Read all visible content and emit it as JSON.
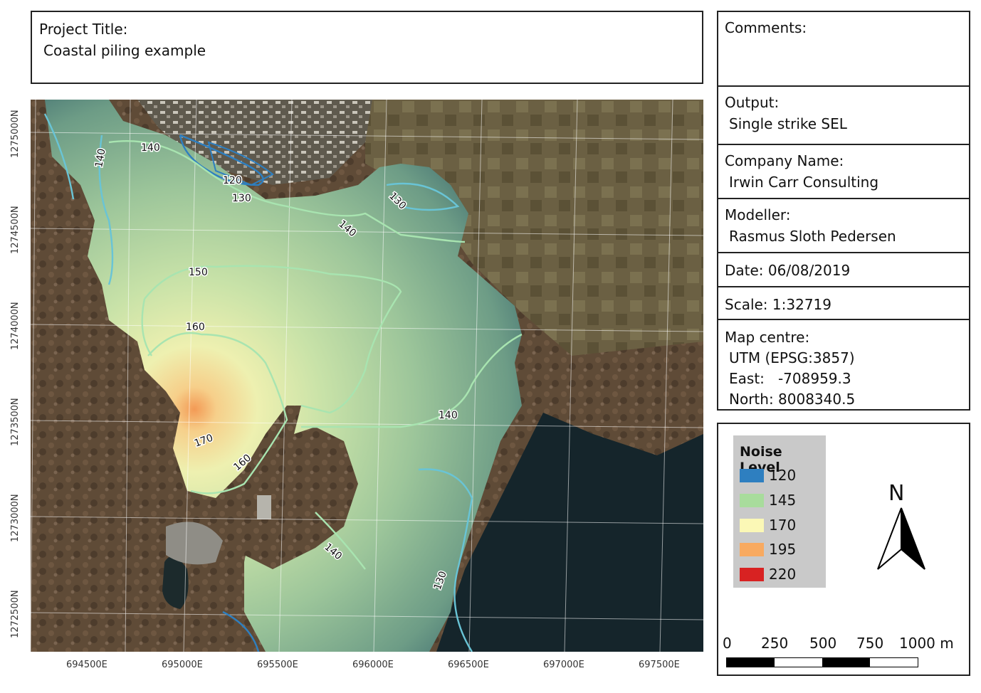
{
  "project": {
    "title_label": "Project Title:",
    "title_value": "Coastal piling example"
  },
  "info": {
    "comments_label": "Comments:",
    "output_label": "Output:",
    "output_value": "Single strike SEL",
    "company_label": "Company Name:",
    "company_value": "Irwin Carr Consulting",
    "modeller_label": "Modeller:",
    "modeller_value": "Rasmus Sloth Pedersen",
    "date": "Date: 06/08/2019",
    "scale": "Scale: 1:32719",
    "map_centre_label": "Map centre:",
    "utm": "UTM (EPSG:3857)",
    "east": "East:   -708959.3",
    "north": "North: 8008340.5"
  },
  "legend": {
    "title": "Noise Level",
    "items": [
      {
        "label": "120",
        "color": "#2e7fc0"
      },
      {
        "label": "145",
        "color": "#a8dc9c"
      },
      {
        "label": "170",
        "color": "#fbf8b6"
      },
      {
        "label": "195",
        "color": "#f8aa60"
      },
      {
        "label": "220",
        "color": "#d82222"
      }
    ]
  },
  "north_arrow": {
    "label": "N"
  },
  "scalebar": {
    "labels": [
      "0",
      "250",
      "500",
      "750",
      "1000 m"
    ]
  },
  "map": {
    "x_ticks": [
      "694500E",
      "695000E",
      "695500E",
      "696000E",
      "696500E",
      "697000E",
      "697500E"
    ],
    "y_ticks": [
      "1275000N",
      "1274500N",
      "1274000N",
      "1273500N",
      "1273000N",
      "1272500N"
    ],
    "contour_labels": [
      "140",
      "140",
      "120",
      "130",
      "130",
      "140",
      "150",
      "160",
      "170",
      "160",
      "140",
      "140",
      "130"
    ],
    "colors": {
      "land": "#5e4a36",
      "sea": "#1f3a40",
      "contour_blue": "#69c4d6",
      "contour_green": "#9fe4ae"
    }
  }
}
